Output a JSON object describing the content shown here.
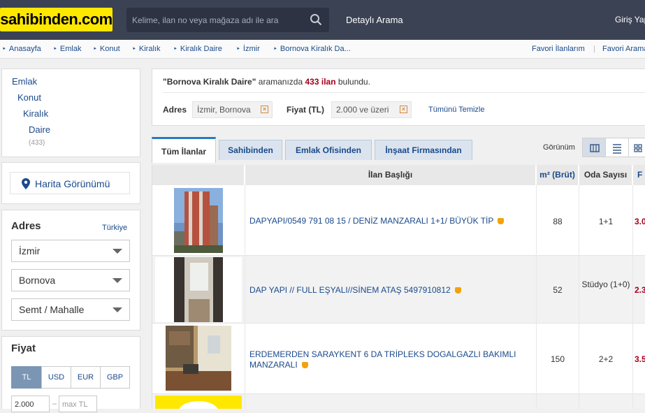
{
  "header": {
    "logo": "sahibinden.com",
    "search_placeholder": "Kelime, ilan no veya mağaza adı ile ara",
    "advanced_search": "Detaylı Arama",
    "login": "Giriş Yap"
  },
  "breadcrumb": {
    "items": [
      "Anasayfa",
      "Emlak",
      "Konut",
      "Kiralık",
      "Kiralık Daire",
      "İzmir",
      "Bornova Kiralık Da..."
    ],
    "fav_listings": "Favori İlanlarım",
    "fav_searches": "Favori Aramalar"
  },
  "category": {
    "items": [
      "Emlak",
      "Konut",
      "Kiralık",
      "Daire"
    ],
    "count": "(433)"
  },
  "map_view": "Harita Görünümü",
  "address": {
    "title": "Adres",
    "country_link": "Türkiye",
    "city": "İzmir",
    "district": "Bornova",
    "neighborhood": "Semt / Mahalle"
  },
  "price": {
    "title": "Fiyat",
    "currencies": [
      "TL",
      "USD",
      "EUR",
      "GBP"
    ],
    "min_value": "2.000",
    "max_placeholder": "max TL"
  },
  "results": {
    "query": "\"Bornova Kiralık Daire\"",
    "middle": "aramanızda",
    "count": "433 ilan",
    "suffix": "bulundu.",
    "filter_address_label": "Adres",
    "filter_address_value": "İzmir, Bornova",
    "filter_price_label": "Fiyat (TL)",
    "filter_price_value": "2.000 ve üzeri",
    "clear_all": "Tümünü Temizle"
  },
  "tabs": [
    "Tüm İlanlar",
    "Sahibinden",
    "Emlak Ofisinden",
    "İnşaat Firmasından"
  ],
  "view_label": "Görünüm",
  "table": {
    "headers": [
      "İlan Başlığı",
      "m² (Brüt)",
      "Oda Sayısı",
      "F"
    ],
    "rows": [
      {
        "title": "DAPYAPI/0549 791 08 15 / DENİZ MANZARALI 1+1/ BÜYÜK TİP",
        "m2": "88",
        "rooms": "1+1",
        "price": "3.0"
      },
      {
        "title": "DAP YAPI // FULL EŞYALI//SİNEM ATAŞ 5497910812",
        "m2": "52",
        "rooms": "Stüdyo (1+0)",
        "price": "2.3"
      },
      {
        "title": "ERDEMERDEN SARAYKENT 6 DA TRİPLEKS DOGALGAZLI BAKIMLI MANZARALI",
        "m2": "150",
        "rooms": "2+2",
        "price": "3.5"
      }
    ]
  },
  "colors": {
    "header_bg": "#3b4254",
    "logo_bg": "#ffe800",
    "link": "#1a4a8b",
    "price": "#a5001b"
  }
}
